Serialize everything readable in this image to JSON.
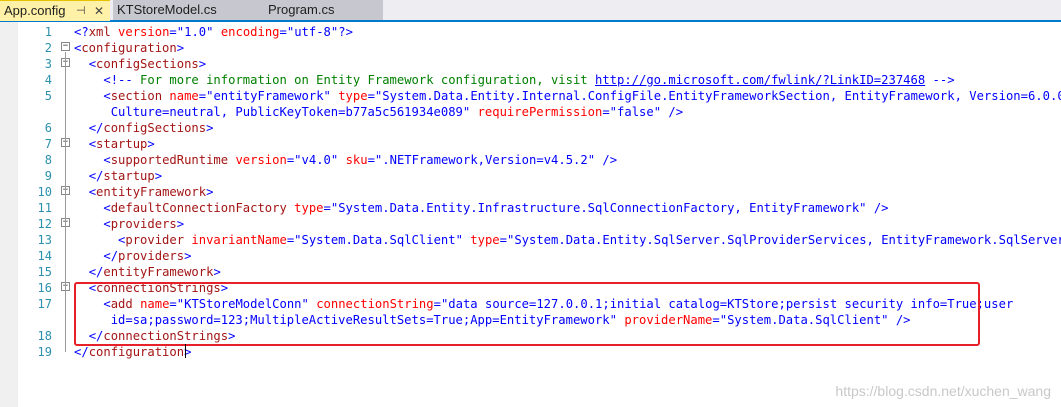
{
  "tabs": {
    "active": {
      "label": "App.config",
      "pin": "⊣",
      "close": "✕"
    },
    "others": [
      {
        "label": "KTStoreModel.cs"
      },
      {
        "label": "Program.cs"
      }
    ]
  },
  "editor": {
    "line_numbers": [
      "1",
      "2",
      "3",
      "4",
      "5",
      "6",
      "7",
      "8",
      "9",
      "10",
      "11",
      "12",
      "13",
      "14",
      "15",
      "16",
      "17",
      "18",
      "19"
    ],
    "watermark": "https://blog.csdn.net/xuchen_wang"
  }
}
